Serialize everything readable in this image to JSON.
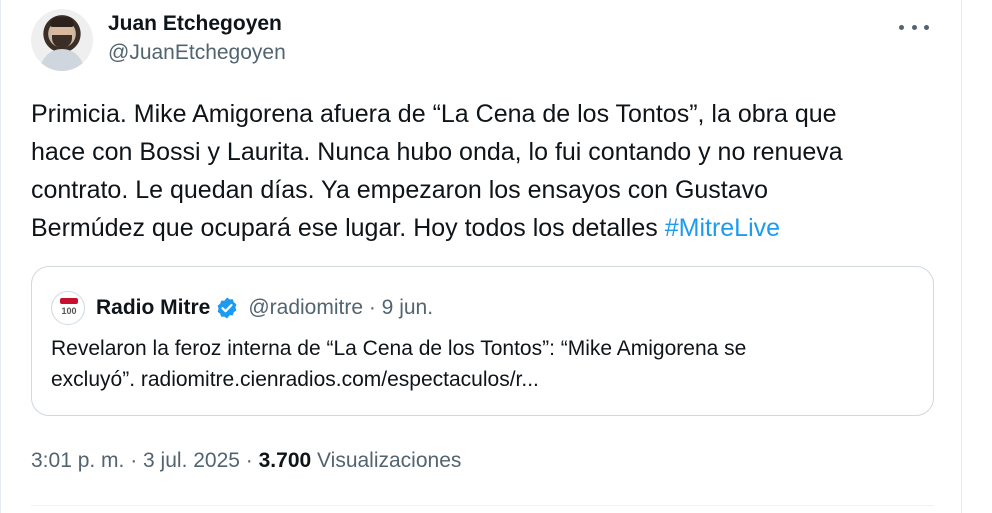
{
  "author": {
    "display_name": "Juan Etchegoyen",
    "handle": "@JuanEtchegoyen"
  },
  "tweet": {
    "text": "Primicia. Mike Amigorena afuera de  “La Cena de los Tontos”, la obra que\nhace con Bossi y Laurita. Nunca hubo onda, lo fui contando y no renueva\ncontrato. Le quedan días. Ya empezaron los ensayos con Gustavo\nBermúdez que ocupará ese lugar. Hoy todos los detalles ",
    "hashtag": "#MitreLive"
  },
  "quoted": {
    "name": "Radio Mitre",
    "handle_date": "@radiomitre · 9 jun.",
    "text": "Revelaron la feroz interna de “La Cena de los Tontos”: “Mike Amigorena se\nexcluyó”. radiomitre.cienradios.com/espectaculos/r...",
    "avatar_text": "100",
    "verified_color": "#1d9bf0"
  },
  "meta": {
    "timestamp": "3:01 p. m. · 3 jul. 2025 · ",
    "views_count": "3.700",
    "views_label": " Visualizaciones"
  },
  "icons": {
    "more": "more-horizontal-icon",
    "verified": "verified-badge-icon"
  },
  "colors": {
    "link": "#1d9bf0",
    "secondary_text": "#536471",
    "border": "#cfd9de"
  }
}
